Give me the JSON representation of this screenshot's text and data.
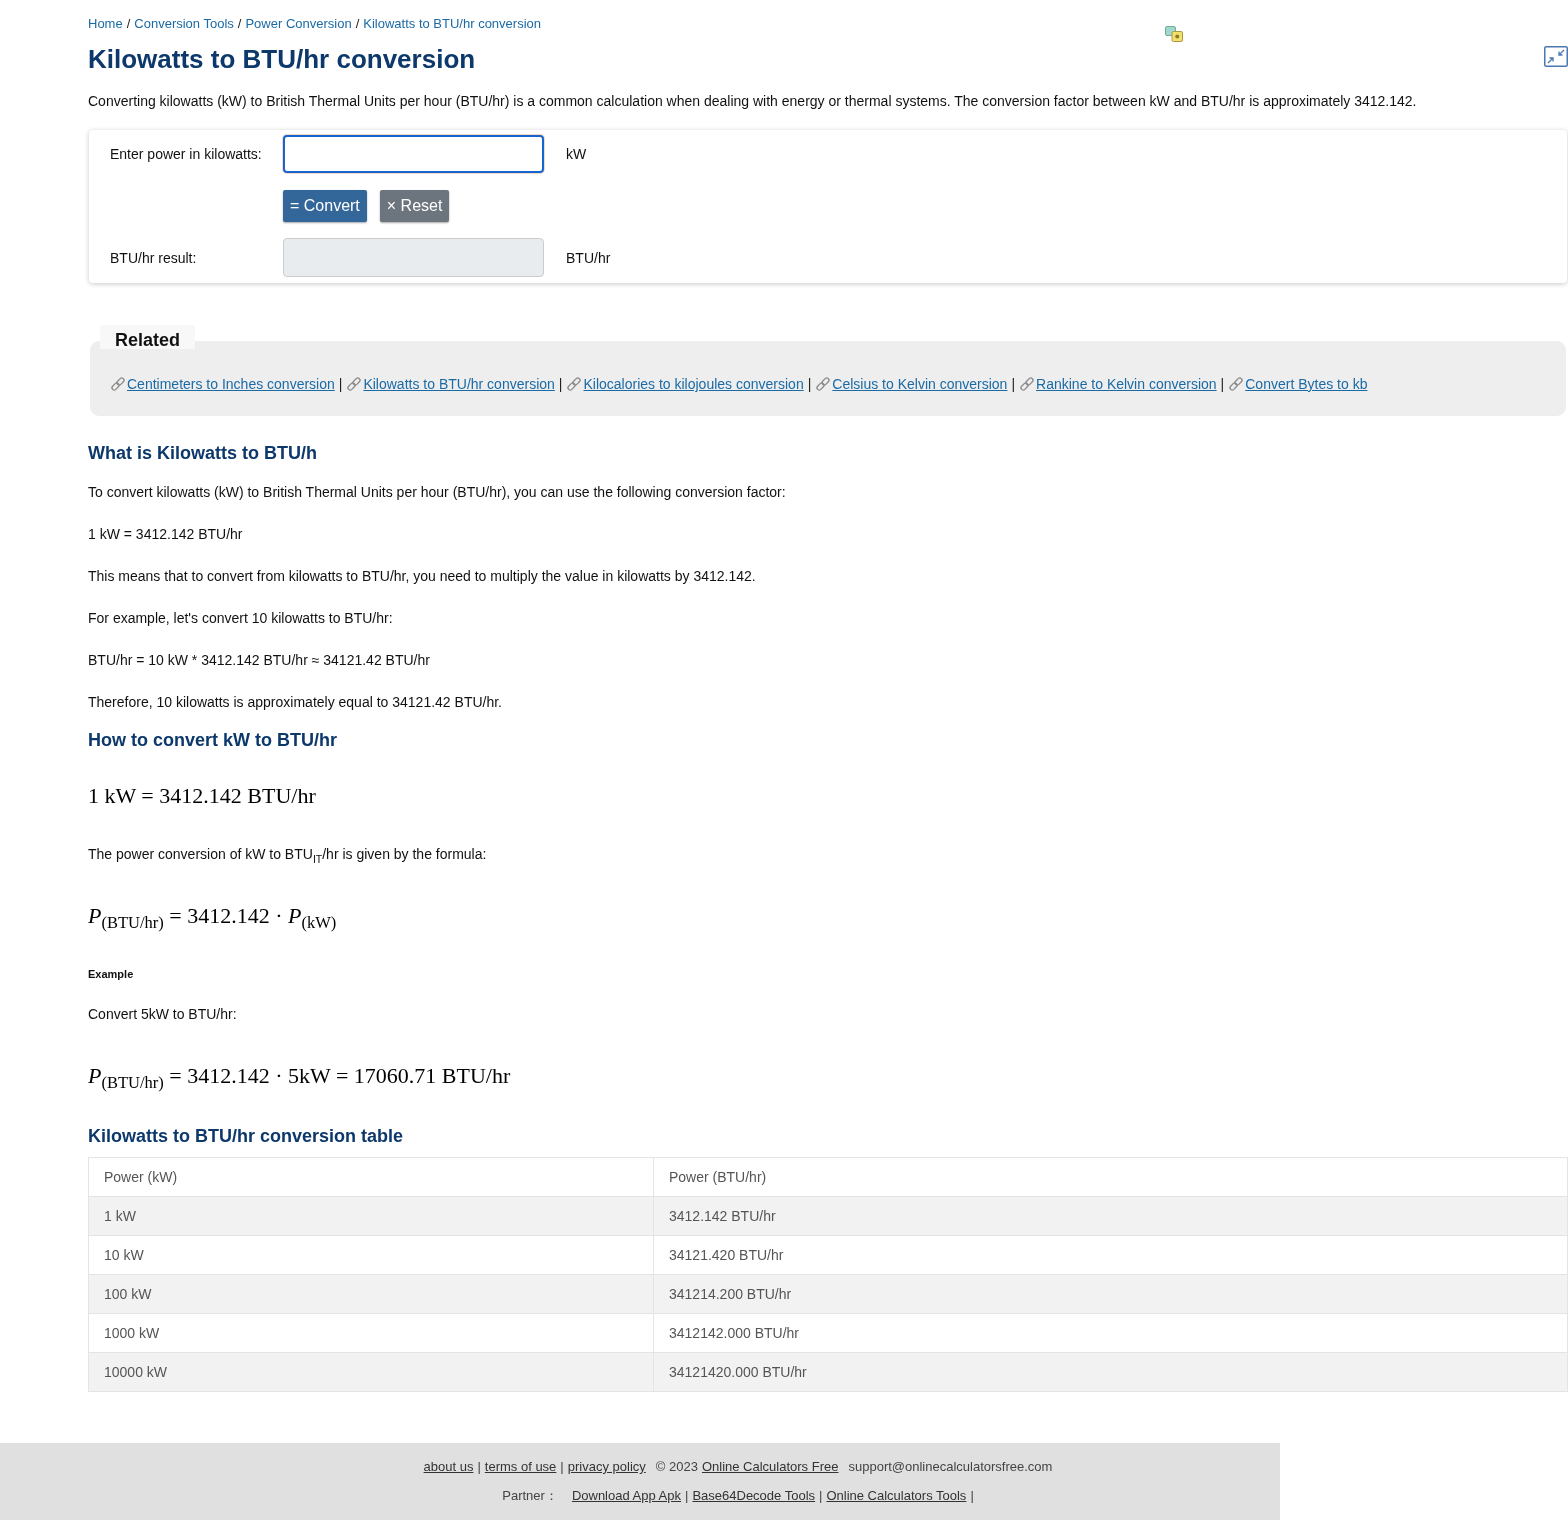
{
  "breadcrumb": {
    "items": [
      "Home",
      "Conversion Tools",
      "Power Conversion",
      "Kilowatts to BTU/hr conversion"
    ],
    "separator": "/"
  },
  "title": "Kilowatts to BTU/hr conversion",
  "intro": "Converting kilowatts (kW) to British Thermal Units per hour (BTU/hr) is a common calculation when dealing with energy or thermal systems. The conversion factor between kW and BTU/hr is approximately 3412.142.",
  "converter": {
    "rows": [
      {
        "kind": "field",
        "label": "Enter power in kilowatts:",
        "unit": "kW",
        "focused": true
      },
      {
        "kind": "buttons",
        "buttons": [
          {
            "kind": "primary",
            "label": "= Convert"
          },
          {
            "kind": "secondary",
            "label": "× Reset"
          }
        ]
      },
      {
        "kind": "result",
        "label": "BTU/hr result:",
        "unit": "BTU/hr",
        "focused": false
      }
    ]
  },
  "related": {
    "title": "Related",
    "separator": "|",
    "links": [
      "Centimeters to Inches conversion",
      "Kilowatts to BTU/hr conversion",
      "Kilocalories to kilojoules conversion",
      "Celsius to Kelvin conversion",
      "Rankine to Kelvin conversion",
      "Convert Bytes to kb"
    ]
  },
  "content": [
    {
      "kind": "heading",
      "text": "What is Kilowatts to BTU/h"
    },
    {
      "kind": "paragraph",
      "text": "To convert kilowatts (kW) to British Thermal Units per hour (BTU/hr), you can use the following conversion factor:"
    },
    {
      "kind": "paragraph",
      "text": "1 kW = 3412.142 BTU/hr"
    },
    {
      "kind": "paragraph",
      "text": "This means that to convert from kilowatts to BTU/hr, you need to multiply the value in kilowatts by 3412.142."
    },
    {
      "kind": "paragraph",
      "text": "For example, let's convert 10 kilowatts to BTU/hr:"
    },
    {
      "kind": "paragraph",
      "text": "BTU/hr = 10 kW * 3412.142 BTU/hr ≈ 34121.42 BTU/hr"
    },
    {
      "kind": "paragraph",
      "text": "Therefore, 10 kilowatts is approximately equal to 34121.42 BTU/hr."
    },
    {
      "kind": "heading",
      "text": "How to convert kW to BTU/hr"
    },
    {
      "kind": "formula",
      "text": "1 kW = 3412.142 BTU/hr"
    },
    {
      "kind": "paragraph",
      "text": "The power conversion of kW to BTU$_{IT}$/hr is given by the formula:"
    },
    {
      "kind": "formula",
      "text": "*P*$_{(BTU/hr)}$ = 3412.142 · *P*$_{(kW)}$"
    },
    {
      "kind": "label",
      "text": "Example"
    },
    {
      "kind": "paragraph",
      "text": "Convert 5kW to BTU/hr:"
    },
    {
      "kind": "formula",
      "text": "*P*$_{(BTU/hr)}$ = 3412.142 · 5kW = 17060.71 BTU/hr"
    },
    {
      "kind": "heading",
      "text": "Kilowatts to BTU/hr conversion table"
    }
  ],
  "table": {
    "columns": [
      "Power (kW)",
      "Power (BTU/hr)"
    ],
    "rows": [
      [
        "1 kW",
        "3412.142 BTU/hr"
      ],
      [
        "10 kW",
        "34121.420 BTU/hr"
      ],
      [
        "100 kW",
        "341214.200 BTU/hr"
      ],
      [
        "1000 kW",
        "3412142.000 BTU/hr"
      ],
      [
        "10000 kW",
        "34121420.000 BTU/hr"
      ]
    ]
  },
  "footer": {
    "lines": [
      [
        {
          "kind": "link",
          "text": "about us"
        },
        {
          "kind": "separator",
          "text": "|"
        },
        {
          "kind": "link",
          "text": "terms of use"
        },
        {
          "kind": "separator",
          "text": "|"
        },
        {
          "kind": "link",
          "text": "privacy policy"
        },
        {
          "kind": "text",
          "text": "© 2023"
        },
        {
          "kind": "link",
          "text": "Online Calculators Free"
        },
        {
          "kind": "text",
          "text": "support@onlinecalculatorsfree.com"
        }
      ],
      [
        {
          "kind": "text",
          "text": "Partner："
        },
        {
          "kind": "link",
          "text": "Download App Apk"
        },
        {
          "kind": "separator",
          "text": "|"
        },
        {
          "kind": "link",
          "text": "Base64Decode Tools"
        },
        {
          "kind": "separator",
          "text": "|"
        },
        {
          "kind": "link",
          "text": "Online Calculators Tools"
        },
        {
          "kind": "separator",
          "text": "|"
        }
      ]
    ]
  }
}
